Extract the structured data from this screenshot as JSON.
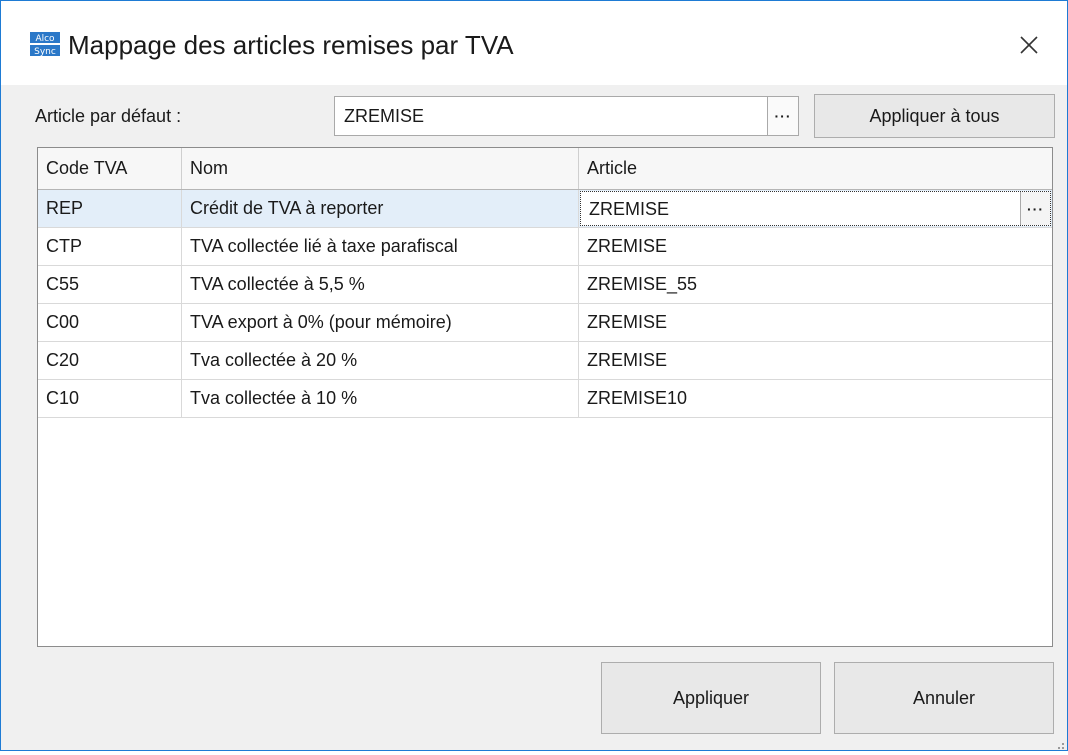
{
  "window": {
    "title": "Mappage des articles remises par TVA",
    "icon": "alco-sync-app-icon",
    "accent_color": "#1e7bd4"
  },
  "default_article": {
    "label": "Article par défaut :",
    "value": "ZREMISE",
    "browse_label": "···",
    "apply_all_label": "Appliquer à tous"
  },
  "grid": {
    "columns": [
      "Code TVA",
      "Nom",
      "Article"
    ],
    "rows": [
      {
        "code": "REP",
        "nom": "Crédit de TVA à reporter",
        "article": "ZREMISE"
      },
      {
        "code": "CTP",
        "nom": "TVA collectée lié à taxe parafiscal",
        "article": "ZREMISE"
      },
      {
        "code": "C55",
        "nom": "TVA collectée à 5,5 %",
        "article": "ZREMISE_55"
      },
      {
        "code": "C00",
        "nom": "TVA export à 0% (pour mémoire)",
        "article": "ZREMISE"
      },
      {
        "code": "C20",
        "nom": "Tva collectée à 20 %",
        "article": "ZREMISE"
      },
      {
        "code": "C10",
        "nom": "Tva collectée à 10 %",
        "article": "ZREMISE10"
      }
    ],
    "selected_row": 0,
    "editor_browse_label": "···",
    "selected_color": "#e3eef9"
  },
  "buttons": {
    "apply_label": "Appliquer",
    "cancel_label": "Annuler"
  }
}
